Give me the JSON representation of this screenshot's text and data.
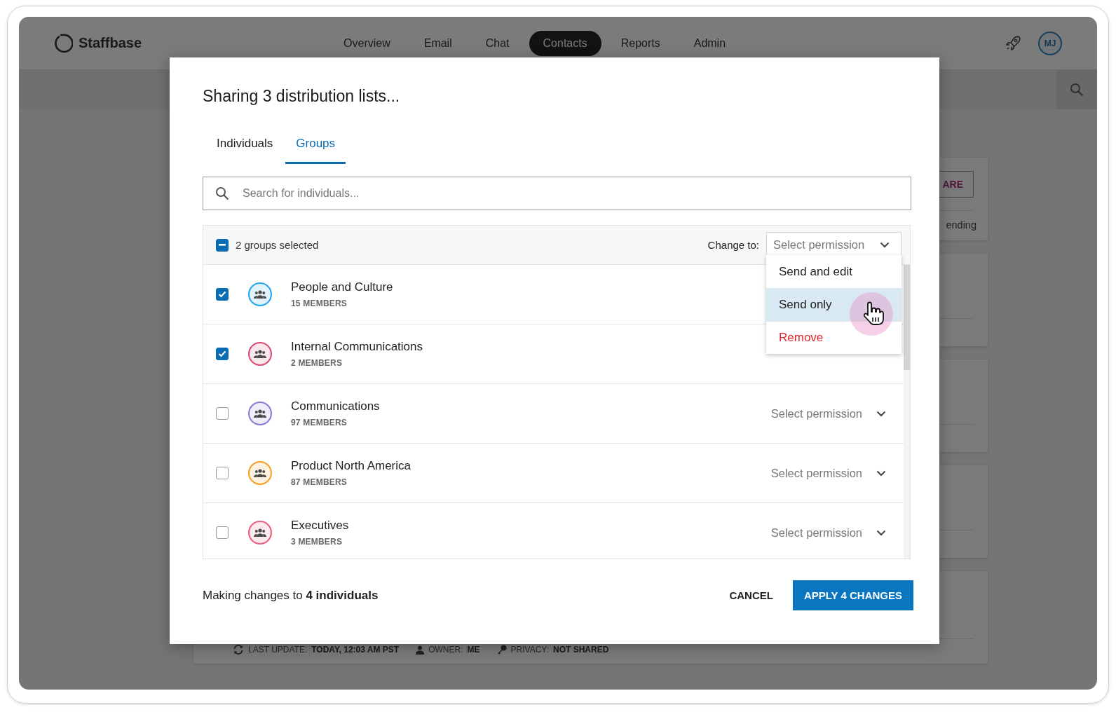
{
  "app": {
    "logo": "Staffbase",
    "nav": [
      {
        "label": "Overview",
        "selected": false
      },
      {
        "label": "Email",
        "selected": false
      },
      {
        "label": "Chat",
        "selected": false
      },
      {
        "label": "Contacts",
        "selected": true
      },
      {
        "label": "Reports",
        "selected": false
      },
      {
        "label": "Admin",
        "selected": false
      }
    ],
    "avatar": "MJ"
  },
  "cards": [
    {
      "kind": "share",
      "button": "ARE",
      "status": "ending"
    },
    {
      "kind": "menu"
    },
    {
      "kind": "menu"
    },
    {
      "kind": "menu"
    },
    {
      "kind": "meta",
      "meta": [
        {
          "kind": "sync",
          "label": "LAST UPDATE:",
          "value": "TODAY, 12:03 AM PST"
        },
        {
          "kind": "owner",
          "label": "OWNER:",
          "value": "ME"
        },
        {
          "kind": "privacy",
          "label": "PRIVACY:",
          "value": "NOT SHARED"
        }
      ]
    }
  ],
  "dialog": {
    "title": "Sharing 3 distribution lists...",
    "tabs": [
      {
        "label": "Individuals",
        "selected": false
      },
      {
        "label": "Groups",
        "selected": true
      }
    ],
    "search": {
      "placeholder": "Search for individuals..."
    },
    "bulk": {
      "label": "2 groups selected",
      "indeterminate": true,
      "change_to": "Change to:",
      "select_placeholder": "Select permission",
      "menu": [
        {
          "label": "Send and edit",
          "selected": false,
          "kind": "normal"
        },
        {
          "label": "Send only",
          "selected": true,
          "kind": "normal"
        },
        {
          "label": "Remove",
          "selected": false,
          "kind": "danger"
        }
      ]
    },
    "groups": [
      {
        "name": "People and Culture",
        "members": "15 MEMBERS",
        "checked": true,
        "color": "#22a6ef"
      },
      {
        "name": "Internal Communications",
        "members": "2 MEMBERS",
        "checked": true,
        "color": "#d84a70"
      },
      {
        "name": "Communications",
        "members": "97 MEMBERS",
        "checked": false,
        "color": "#8a79d2",
        "permission": "Select permission"
      },
      {
        "name": "Product North America",
        "members": "87 MEMBERS",
        "checked": false,
        "color": "#f5a01f",
        "permission": "Select permission"
      },
      {
        "name": "Executives",
        "members": "3 MEMBERS",
        "checked": false,
        "color": "#e8607c",
        "permission": "Select permission"
      }
    ],
    "footer": {
      "summary": "Making changes to **4 individuals**",
      "cancel": "CANCEL",
      "apply": "APPLY 4 CHANGES"
    }
  }
}
